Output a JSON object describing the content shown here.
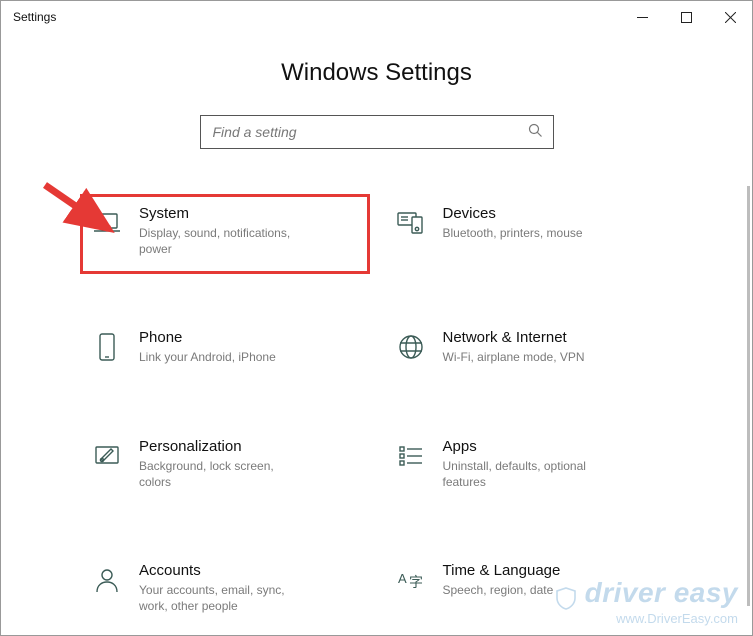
{
  "window": {
    "title": "Settings"
  },
  "page": {
    "heading": "Windows Settings"
  },
  "search": {
    "placeholder": "Find a setting"
  },
  "tiles": [
    {
      "key": "system",
      "title": "System",
      "desc": "Display, sound, notifications, power",
      "highlighted": true
    },
    {
      "key": "devices",
      "title": "Devices",
      "desc": "Bluetooth, printers, mouse"
    },
    {
      "key": "phone",
      "title": "Phone",
      "desc": "Link your Android, iPhone"
    },
    {
      "key": "network",
      "title": "Network & Internet",
      "desc": "Wi-Fi, airplane mode, VPN"
    },
    {
      "key": "personalization",
      "title": "Personalization",
      "desc": "Background, lock screen, colors"
    },
    {
      "key": "apps",
      "title": "Apps",
      "desc": "Uninstall, defaults, optional features"
    },
    {
      "key": "accounts",
      "title": "Accounts",
      "desc": "Your accounts, email, sync, work, other people"
    },
    {
      "key": "time",
      "title": "Time & Language",
      "desc": "Speech, region, date"
    }
  ],
  "watermark": {
    "brand": "driver easy",
    "url": "www.DriverEasy.com"
  }
}
